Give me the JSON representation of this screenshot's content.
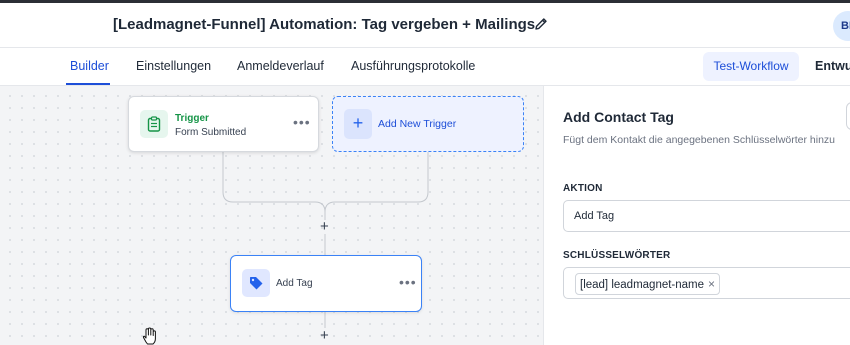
{
  "header": {
    "title": "[Leadmagnet-Funnel] Automation: Tag vergeben + Mailings",
    "avatar_initials": "BI"
  },
  "tabs": [
    {
      "label": "Builder",
      "active": true
    },
    {
      "label": "Einstellungen",
      "active": false
    },
    {
      "label": "Anmeldeverlauf",
      "active": false
    },
    {
      "label": "Ausführungsprotokolle",
      "active": false
    }
  ],
  "toolbar": {
    "test_workflow_label": "Test-Workflow",
    "draft_label": "Entwurf"
  },
  "canvas": {
    "trigger_node": {
      "title": "Trigger",
      "subtitle": "Form Submitted",
      "icon": "clipboard-icon",
      "menu": "•••"
    },
    "add_trigger_node": {
      "label": "Add New Trigger",
      "icon": "plus-icon",
      "plus": "+"
    },
    "action_node": {
      "label": "Add Tag",
      "icon": "tag-icon",
      "menu": "•••"
    },
    "plus_symbol": "+"
  },
  "panel": {
    "title": "Add Contact Tag",
    "description": "Fügt dem Kontakt die angegebenen Schlüsselwörter hinzu",
    "action_label": "AKTION",
    "action_value": "Add Tag",
    "keywords_label": "SCHLÜSSELWÖRTER",
    "keywords": [
      "[lead] leadmagnet-name"
    ],
    "chip_remove": "×"
  },
  "colors": {
    "accent": "#1d4ed8",
    "trigger_green": "#159447",
    "canvas_bg": "#f3f4f6"
  }
}
